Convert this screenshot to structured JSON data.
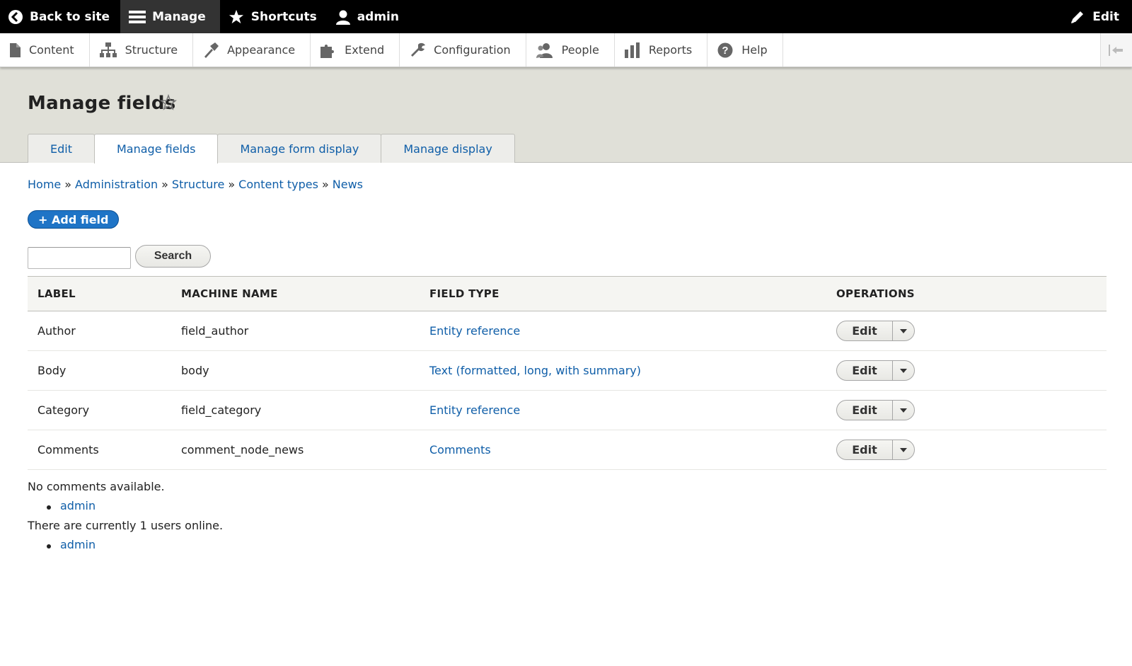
{
  "toolbar": {
    "back_to_site": "Back to site",
    "manage": "Manage",
    "shortcuts": "Shortcuts",
    "user": "admin",
    "edit": "Edit"
  },
  "tray": {
    "items": [
      {
        "label": "Content",
        "icon": "document-icon"
      },
      {
        "label": "Structure",
        "icon": "sitemap-icon"
      },
      {
        "label": "Appearance",
        "icon": "paintbrush-icon"
      },
      {
        "label": "Extend",
        "icon": "puzzle-icon"
      },
      {
        "label": "Configuration",
        "icon": "wrench-icon"
      },
      {
        "label": "People",
        "icon": "people-icon"
      },
      {
        "label": "Reports",
        "icon": "bar-chart-icon"
      },
      {
        "label": "Help",
        "icon": "help-icon"
      }
    ]
  },
  "page": {
    "title": "Manage fields"
  },
  "tabs": [
    {
      "label": "Edit",
      "active": false
    },
    {
      "label": "Manage fields",
      "active": true
    },
    {
      "label": "Manage form display",
      "active": false
    },
    {
      "label": "Manage display",
      "active": false
    }
  ],
  "breadcrumb": {
    "items": [
      "Home",
      "Administration",
      "Structure",
      "Content types",
      "News"
    ],
    "separator": "»"
  },
  "actions": {
    "add_field": "+ Add field"
  },
  "search": {
    "value": "",
    "button": "Search"
  },
  "table": {
    "headers": [
      "LABEL",
      "MACHINE NAME",
      "FIELD TYPE",
      "OPERATIONS"
    ],
    "rows": [
      {
        "label": "Author",
        "machine": "field_author",
        "type": "Entity reference",
        "op": "Edit"
      },
      {
        "label": "Body",
        "machine": "body",
        "type": "Text (formatted, long, with summary)",
        "op": "Edit"
      },
      {
        "label": "Category",
        "machine": "field_category",
        "type": "Entity reference",
        "op": "Edit"
      },
      {
        "label": "Comments",
        "machine": "comment_node_news",
        "type": "Comments",
        "op": "Edit"
      }
    ]
  },
  "blocks": {
    "no_comments": "No comments available.",
    "user_list_1": "admin",
    "online": "There are currently 1 users online.",
    "user_list_2": "admin"
  },
  "colors": {
    "link": "#0f5ea8",
    "primary_button": "#1f74c6",
    "toolbar": "#000000",
    "header_bg": "#e0e0d8"
  }
}
